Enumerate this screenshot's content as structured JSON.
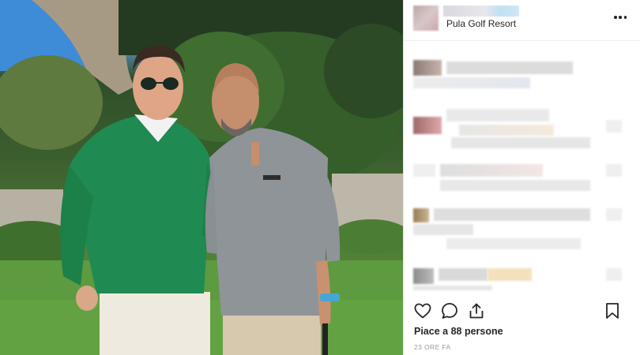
{
  "post": {
    "location": "Pula Golf Resort",
    "likes_text": "Piace a 88 persone",
    "timestamp": "23 ORE FA"
  },
  "icons": {
    "more": "more-options-icon",
    "like": "heart-icon",
    "comment": "comment-icon",
    "share": "share-icon",
    "save": "bookmark-icon"
  },
  "colors": {
    "text": "#262626",
    "muted": "#999999",
    "divider": "#efefef"
  }
}
